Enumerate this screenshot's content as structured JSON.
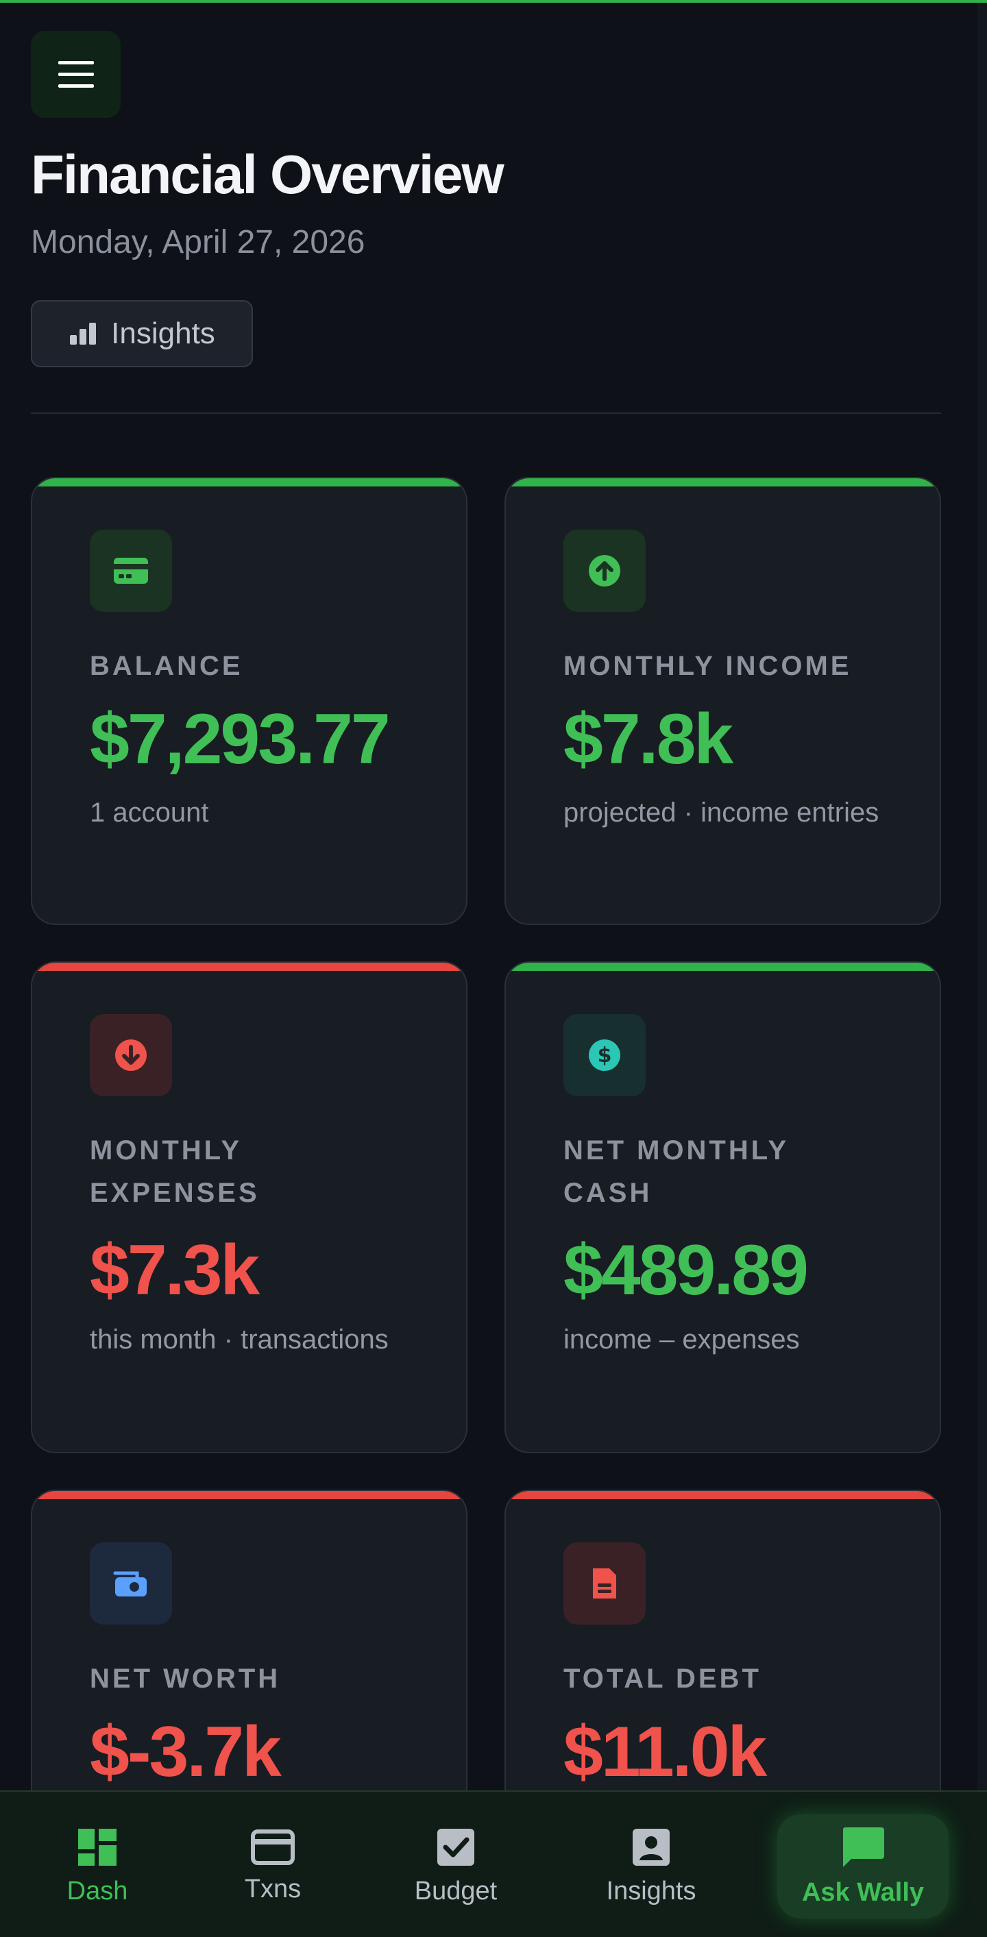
{
  "header": {
    "title": "Financial Overview",
    "date": "Monday, April 27, 2026",
    "insights_label": "Insights"
  },
  "cards": [
    {
      "label": "BALANCE",
      "value": "$7,293.77",
      "sub": "1 account",
      "tone": "green",
      "icon": "credit-card-icon"
    },
    {
      "label": "MONTHLY INCOME",
      "value": "$7.8k",
      "sub": "projected · income entries",
      "tone": "green",
      "icon": "arrow-up-circle-icon"
    },
    {
      "label": "MONTHLY EXPENSES",
      "value": "$7.3k",
      "sub": "this month · transactions",
      "tone": "red",
      "icon": "arrow-down-circle-icon"
    },
    {
      "label": "NET MONTHLY CASH",
      "value": "$489.89",
      "sub": "income – expenses",
      "tone": "green",
      "icon": "dollar-circle-icon"
    },
    {
      "label": "NET WORTH",
      "value": "$-3.7k",
      "sub": "",
      "tone": "red",
      "icon": "wallet-icon"
    },
    {
      "label": "TOTAL DEBT",
      "value": "$11.0k",
      "sub": "",
      "tone": "red",
      "icon": "document-icon"
    }
  ],
  "nav": {
    "items": [
      {
        "label": "Dash",
        "icon": "dashboard-icon",
        "active": true
      },
      {
        "label": "Txns",
        "icon": "credit-card-icon",
        "active": false
      },
      {
        "label": "Budget",
        "icon": "checkbox-icon",
        "active": false
      },
      {
        "label": "Insights",
        "icon": "person-icon",
        "active": false
      }
    ],
    "wally_label": "Ask Wally",
    "wally_icon": "chat-bubble-icon"
  },
  "colors": {
    "accent_green": "#3fbf55",
    "accent_red": "#f0524c",
    "background": "#0e1117",
    "card": "#181c23"
  }
}
